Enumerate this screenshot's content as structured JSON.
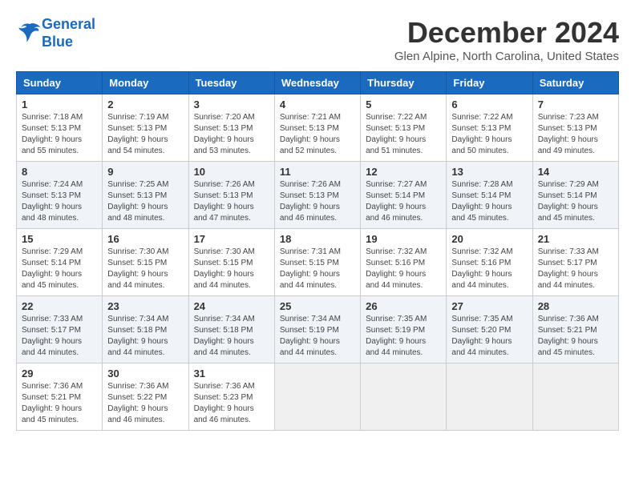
{
  "header": {
    "logo_line1": "General",
    "logo_line2": "Blue",
    "title": "December 2024",
    "subtitle": "Glen Alpine, North Carolina, United States"
  },
  "weekdays": [
    "Sunday",
    "Monday",
    "Tuesday",
    "Wednesday",
    "Thursday",
    "Friday",
    "Saturday"
  ],
  "weeks": [
    [
      {
        "day": "1",
        "info": "Sunrise: 7:18 AM\nSunset: 5:13 PM\nDaylight: 9 hours\nand 55 minutes."
      },
      {
        "day": "2",
        "info": "Sunrise: 7:19 AM\nSunset: 5:13 PM\nDaylight: 9 hours\nand 54 minutes."
      },
      {
        "day": "3",
        "info": "Sunrise: 7:20 AM\nSunset: 5:13 PM\nDaylight: 9 hours\nand 53 minutes."
      },
      {
        "day": "4",
        "info": "Sunrise: 7:21 AM\nSunset: 5:13 PM\nDaylight: 9 hours\nand 52 minutes."
      },
      {
        "day": "5",
        "info": "Sunrise: 7:22 AM\nSunset: 5:13 PM\nDaylight: 9 hours\nand 51 minutes."
      },
      {
        "day": "6",
        "info": "Sunrise: 7:22 AM\nSunset: 5:13 PM\nDaylight: 9 hours\nand 50 minutes."
      },
      {
        "day": "7",
        "info": "Sunrise: 7:23 AM\nSunset: 5:13 PM\nDaylight: 9 hours\nand 49 minutes."
      }
    ],
    [
      {
        "day": "8",
        "info": "Sunrise: 7:24 AM\nSunset: 5:13 PM\nDaylight: 9 hours\nand 48 minutes."
      },
      {
        "day": "9",
        "info": "Sunrise: 7:25 AM\nSunset: 5:13 PM\nDaylight: 9 hours\nand 48 minutes."
      },
      {
        "day": "10",
        "info": "Sunrise: 7:26 AM\nSunset: 5:13 PM\nDaylight: 9 hours\nand 47 minutes."
      },
      {
        "day": "11",
        "info": "Sunrise: 7:26 AM\nSunset: 5:13 PM\nDaylight: 9 hours\nand 46 minutes."
      },
      {
        "day": "12",
        "info": "Sunrise: 7:27 AM\nSunset: 5:14 PM\nDaylight: 9 hours\nand 46 minutes."
      },
      {
        "day": "13",
        "info": "Sunrise: 7:28 AM\nSunset: 5:14 PM\nDaylight: 9 hours\nand 45 minutes."
      },
      {
        "day": "14",
        "info": "Sunrise: 7:29 AM\nSunset: 5:14 PM\nDaylight: 9 hours\nand 45 minutes."
      }
    ],
    [
      {
        "day": "15",
        "info": "Sunrise: 7:29 AM\nSunset: 5:14 PM\nDaylight: 9 hours\nand 45 minutes."
      },
      {
        "day": "16",
        "info": "Sunrise: 7:30 AM\nSunset: 5:15 PM\nDaylight: 9 hours\nand 44 minutes."
      },
      {
        "day": "17",
        "info": "Sunrise: 7:30 AM\nSunset: 5:15 PM\nDaylight: 9 hours\nand 44 minutes."
      },
      {
        "day": "18",
        "info": "Sunrise: 7:31 AM\nSunset: 5:15 PM\nDaylight: 9 hours\nand 44 minutes."
      },
      {
        "day": "19",
        "info": "Sunrise: 7:32 AM\nSunset: 5:16 PM\nDaylight: 9 hours\nand 44 minutes."
      },
      {
        "day": "20",
        "info": "Sunrise: 7:32 AM\nSunset: 5:16 PM\nDaylight: 9 hours\nand 44 minutes."
      },
      {
        "day": "21",
        "info": "Sunrise: 7:33 AM\nSunset: 5:17 PM\nDaylight: 9 hours\nand 44 minutes."
      }
    ],
    [
      {
        "day": "22",
        "info": "Sunrise: 7:33 AM\nSunset: 5:17 PM\nDaylight: 9 hours\nand 44 minutes."
      },
      {
        "day": "23",
        "info": "Sunrise: 7:34 AM\nSunset: 5:18 PM\nDaylight: 9 hours\nand 44 minutes."
      },
      {
        "day": "24",
        "info": "Sunrise: 7:34 AM\nSunset: 5:18 PM\nDaylight: 9 hours\nand 44 minutes."
      },
      {
        "day": "25",
        "info": "Sunrise: 7:34 AM\nSunset: 5:19 PM\nDaylight: 9 hours\nand 44 minutes."
      },
      {
        "day": "26",
        "info": "Sunrise: 7:35 AM\nSunset: 5:19 PM\nDaylight: 9 hours\nand 44 minutes."
      },
      {
        "day": "27",
        "info": "Sunrise: 7:35 AM\nSunset: 5:20 PM\nDaylight: 9 hours\nand 44 minutes."
      },
      {
        "day": "28",
        "info": "Sunrise: 7:36 AM\nSunset: 5:21 PM\nDaylight: 9 hours\nand 45 minutes."
      }
    ],
    [
      {
        "day": "29",
        "info": "Sunrise: 7:36 AM\nSunset: 5:21 PM\nDaylight: 9 hours\nand 45 minutes."
      },
      {
        "day": "30",
        "info": "Sunrise: 7:36 AM\nSunset: 5:22 PM\nDaylight: 9 hours\nand 46 minutes."
      },
      {
        "day": "31",
        "info": "Sunrise: 7:36 AM\nSunset: 5:23 PM\nDaylight: 9 hours\nand 46 minutes."
      },
      {
        "day": "",
        "info": ""
      },
      {
        "day": "",
        "info": ""
      },
      {
        "day": "",
        "info": ""
      },
      {
        "day": "",
        "info": ""
      }
    ]
  ]
}
